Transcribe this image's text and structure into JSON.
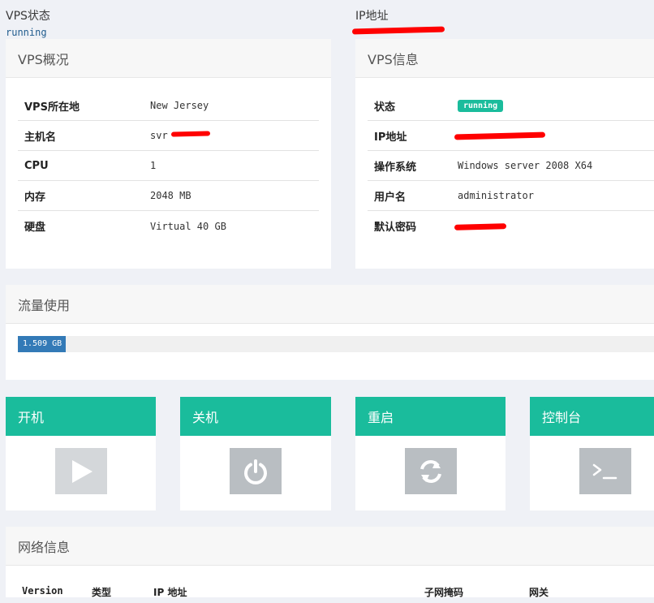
{
  "top": {
    "vps_status_label": "VPS状态",
    "vps_status_value": "running",
    "ip_label": "IP地址"
  },
  "overview": {
    "title": "VPS概况",
    "rows": [
      {
        "label": "VPS所在地",
        "value": "New Jersey"
      },
      {
        "label": "主机名",
        "value": "svr"
      },
      {
        "label": "CPU",
        "value": "1"
      },
      {
        "label": "内存",
        "value": "2048 MB"
      },
      {
        "label": "硬盘",
        "value": "Virtual 40 GB"
      }
    ]
  },
  "info": {
    "title": "VPS信息",
    "rows": [
      {
        "label": "状态",
        "value": "running"
      },
      {
        "label": "IP地址",
        "value": ""
      },
      {
        "label": "操作系统",
        "value": "Windows server 2008 X64"
      },
      {
        "label": "用户名",
        "value": "administrator"
      },
      {
        "label": "默认密码",
        "value": ""
      }
    ]
  },
  "traffic": {
    "title": "流量使用",
    "used_label": "1.509 GB",
    "used_fraction": 0.075
  },
  "actions": [
    {
      "label": "开机",
      "icon": "play-icon"
    },
    {
      "label": "关机",
      "icon": "power-icon"
    },
    {
      "label": "重启",
      "icon": "refresh-icon"
    },
    {
      "label": "控制台",
      "icon": "terminal-icon"
    }
  ],
  "network": {
    "title": "网络信息",
    "columns": [
      "Version",
      "类型",
      "IP 地址",
      "子网掩码",
      "网关"
    ]
  },
  "colors": {
    "accent": "#1abc9c",
    "progress": "#337ab7",
    "redaction": "#ff0000",
    "background": "#eff1f6"
  }
}
